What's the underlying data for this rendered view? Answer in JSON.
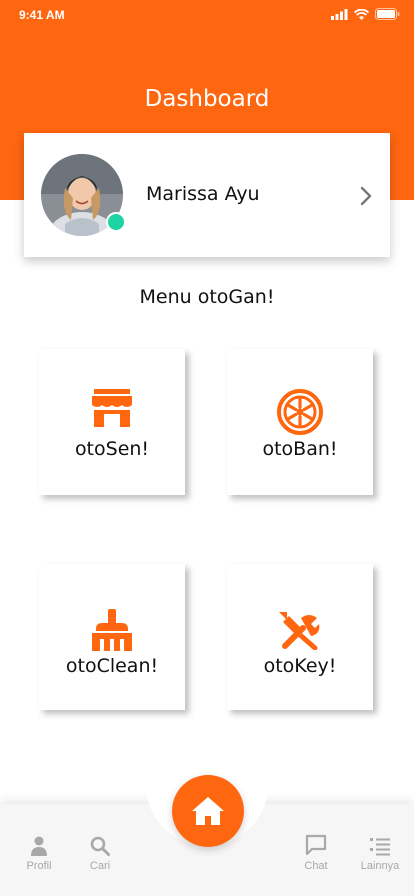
{
  "status_bar": {
    "time": "9:41 AM"
  },
  "header": {
    "title": "Dashboard"
  },
  "profile": {
    "name": "Marissa Ayu",
    "status": "online"
  },
  "menu": {
    "title": "Menu otoGan!",
    "items": [
      {
        "label": "otoSen!",
        "icon": "store-icon"
      },
      {
        "label": "otoBan!",
        "icon": "tire-icon"
      },
      {
        "label": "otoClean!",
        "icon": "broom-icon"
      },
      {
        "label": "otoKey!",
        "icon": "tools-icon"
      }
    ]
  },
  "bottom_nav": {
    "items": [
      {
        "label": "Profil",
        "icon": "person-icon"
      },
      {
        "label": "Cari",
        "icon": "search-icon"
      },
      {
        "label": "Chat",
        "icon": "chat-icon"
      },
      {
        "label": "Lainnya",
        "icon": "list-icon"
      }
    ],
    "center": {
      "icon": "home-icon"
    }
  },
  "colors": {
    "accent": "#ff6610",
    "online": "#1ed4a4",
    "nav_inactive": "#a8a8a8"
  }
}
